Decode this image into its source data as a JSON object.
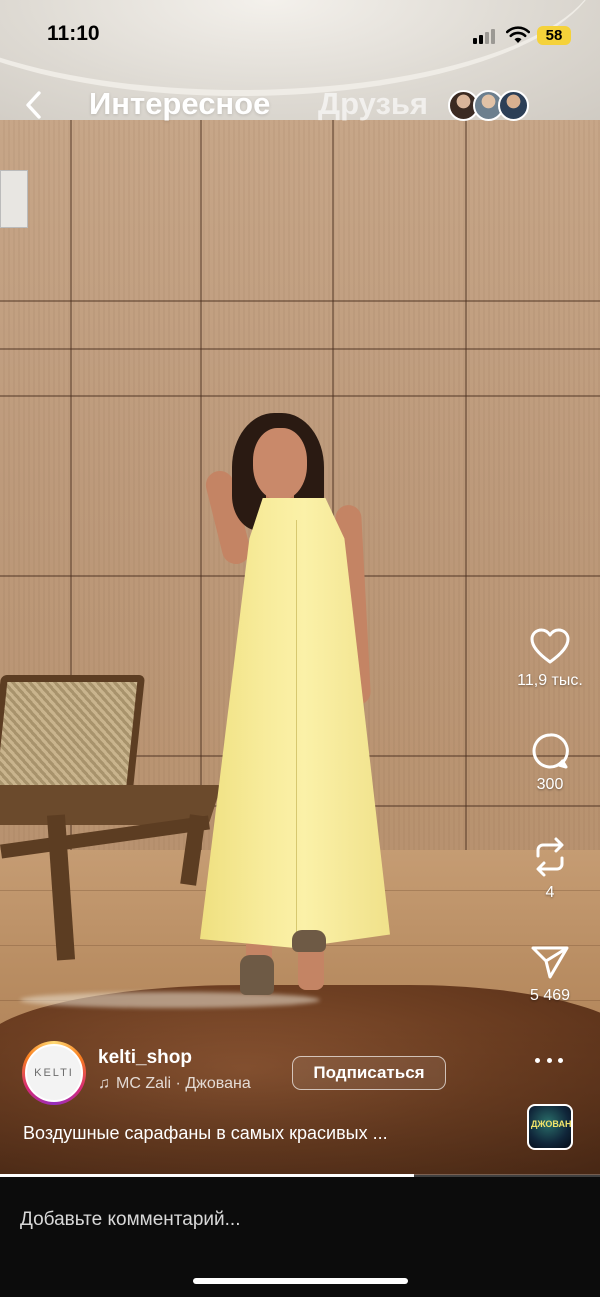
{
  "status_bar": {
    "time": "11:10",
    "battery": "58"
  },
  "nav": {
    "tab_active": "Интересное",
    "tab_inactive": "Друзья"
  },
  "actions": {
    "likes": "11,9 тыс.",
    "comments": "300",
    "reposts": "4",
    "shares": "5 469"
  },
  "post": {
    "avatar_text": "KELTI",
    "username": "kelti_shop",
    "audio": "MC Zali · Джована",
    "subscribe_label": "Подписаться",
    "caption": "Воздушные сарафаны в самых красивых ...",
    "music_thumb_text": "ДЖОВАНА",
    "progress_fraction": 0.69
  },
  "comment": {
    "placeholder": "Добавьте комментарий..."
  },
  "colors": {
    "battery": "#f5d23a",
    "dress": "#f8ec9c",
    "comment_bar": "#0c0c0c"
  },
  "icons": [
    "back-chevron",
    "heart",
    "comment-bubble",
    "repost-arrows",
    "paper-plane",
    "music-note",
    "more-dots"
  ]
}
